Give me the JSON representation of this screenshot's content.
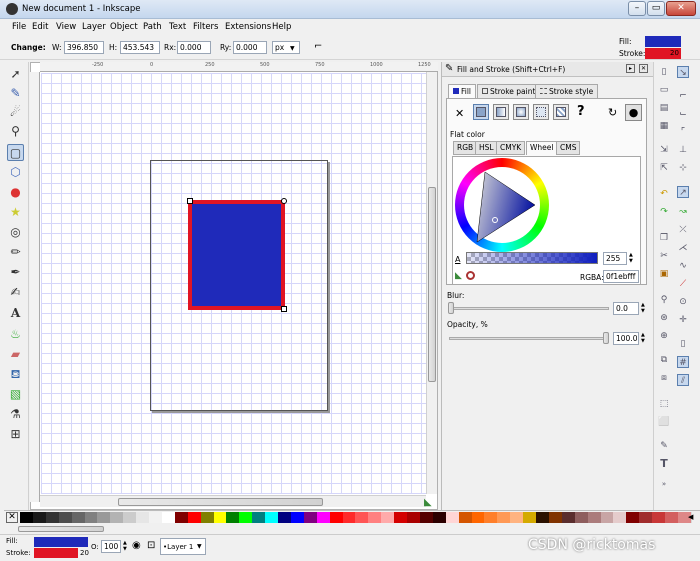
{
  "window": {
    "title": "New document 1 - Inkscape",
    "minimize": "–",
    "maximize": "▭",
    "close": "✕"
  },
  "menu": [
    "File",
    "Edit",
    "View",
    "Layer",
    "Object",
    "Path",
    "Text",
    "Filters",
    "Extensions",
    "Help"
  ],
  "controls": {
    "change_label": "Change:",
    "w_label": "W:",
    "w_value": "396.850",
    "h_label": "H:",
    "h_value": "453.543",
    "rx_label": "Rx:",
    "rx_value": "0.000",
    "ry_label": "Ry:",
    "ry_value": "0.000",
    "unit": "px",
    "fill_label": "Fill:",
    "stroke_label": "Stroke:",
    "stroke_width": "20"
  },
  "colors": {
    "fill": "#1f2aba",
    "stroke": "#e01524",
    "accent": "#5b7fae"
  },
  "ruler": {
    "h_ticks": [
      "-250",
      "0",
      "250",
      "500",
      "750",
      "1000",
      "1250"
    ],
    "v_ticks": [
      "0",
      "250",
      "500",
      "750",
      "1000",
      "1250",
      "1500",
      "1750"
    ]
  },
  "tools": [
    "selector-icon",
    "node-icon",
    "tweak-icon",
    "zoom-icon",
    "rect-icon",
    "3dbox-icon",
    "ellipse-icon",
    "star-icon",
    "spiral-icon",
    "pencil-icon",
    "pen-icon",
    "calligraphy-icon",
    "text-icon",
    "spray-icon",
    "eraser-icon",
    "bucket-icon",
    "gradient-icon",
    "dropper-icon",
    "connector-icon"
  ],
  "dock": {
    "title": "Fill and Stroke (Shift+Ctrl+F)",
    "tabs": [
      "Fill",
      "Stroke paint",
      "Stroke style"
    ],
    "paint_types": [
      "✕",
      "",
      "",
      "",
      "",
      "",
      "?"
    ],
    "flat_color": "Flat color",
    "color_tabs": [
      "RGB",
      "HSL",
      "CMYK",
      "Wheel",
      "CMS"
    ],
    "alpha_label": "A",
    "alpha_value": "255",
    "rgba_label": "RGBA:",
    "rgba_value": "0f1ebfff",
    "blur_label": "Blur:",
    "blur_value": "0.0",
    "opacity_label": "Opacity, %",
    "opacity_value": "100.0"
  },
  "palette": [
    "#000000",
    "#1a1a1a",
    "#333333",
    "#4d4d4d",
    "#666666",
    "#808080",
    "#999999",
    "#b3b3b3",
    "#cccccc",
    "#e6e6e6",
    "#f2f2f2",
    "#ffffff",
    "#800000",
    "#ff0000",
    "#808000",
    "#ffff00",
    "#008000",
    "#00ff00",
    "#008080",
    "#00ffff",
    "#000080",
    "#0000ff",
    "#800080",
    "#ff00ff",
    "#ff0000",
    "#ff2a2a",
    "#ff5555",
    "#ff8080",
    "#ffaaaa",
    "#d40000",
    "#aa0000",
    "#550000",
    "#2b0000",
    "#ffd5d5",
    "#d45500",
    "#ff6600",
    "#ff7f2a",
    "#ff9955",
    "#ffb380",
    "#d4aa00",
    "#2b1100",
    "#803300",
    "#5a2d2d",
    "#8e5e5e",
    "#ab7c7c",
    "#c8a5a5",
    "#e5cccc",
    "#800000",
    "#a02c2c",
    "#c83737",
    "#d35f5f",
    "#de8787"
  ],
  "status": {
    "fill_label": "Fill:",
    "stroke_label": "Stroke:",
    "stroke_width": "20",
    "opacity_label": "O:",
    "opacity_value": "100",
    "layer": "•Layer 1"
  },
  "watermark": "CSDN @ricktomas"
}
